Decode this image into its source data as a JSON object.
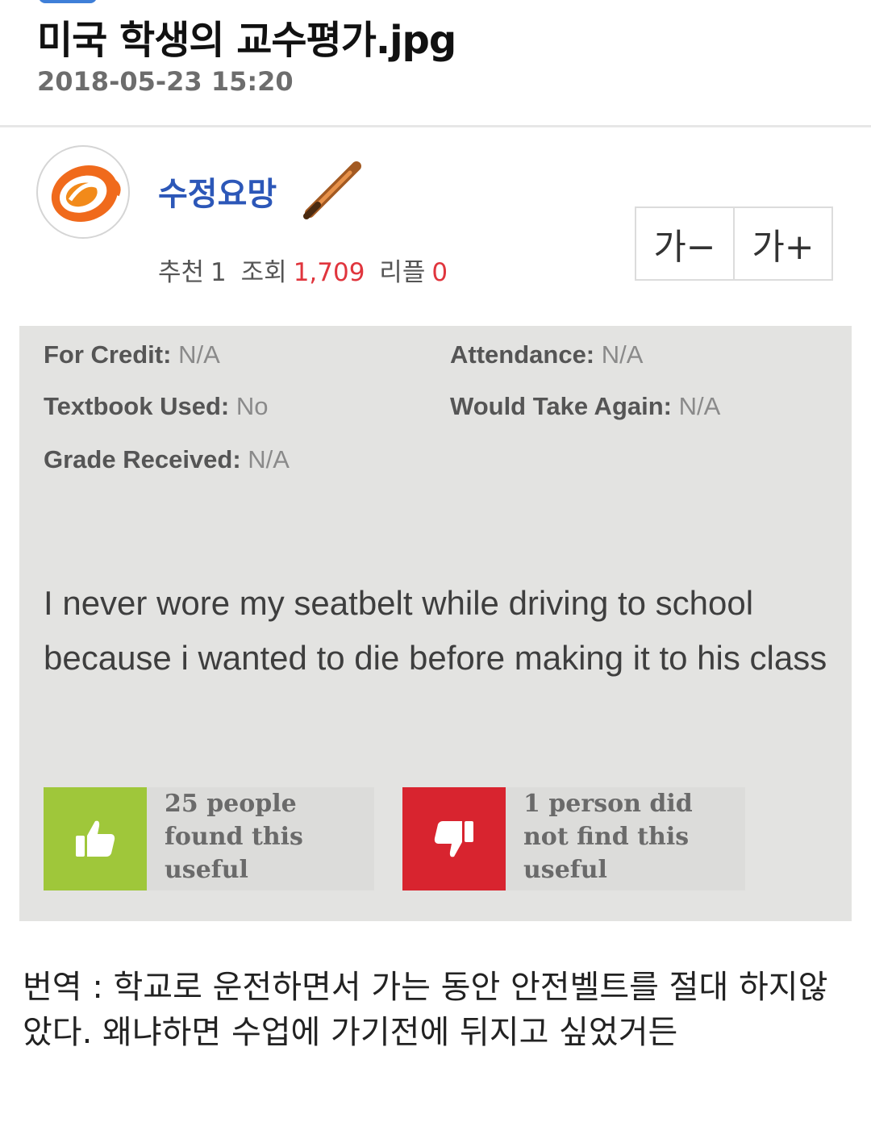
{
  "post": {
    "title": "미국 학생의 교수평가.jpg",
    "datetime": "2018-05-23 15:20"
  },
  "author": {
    "nickname": "수정요망",
    "stats": {
      "recommend_label": "추천",
      "recommend_count": "1",
      "views_label": "조회",
      "views_count": "1,709",
      "replies_label": "리플",
      "replies_count": "0"
    }
  },
  "font_size_controls": {
    "decrease_label": "가−",
    "increase_label": "가+"
  },
  "image_content": {
    "fields": [
      {
        "key": "For Credit:",
        "value": "N/A"
      },
      {
        "key": "Attendance:",
        "value": "N/A"
      },
      {
        "key": "Textbook Used:",
        "value": "No"
      },
      {
        "key": "Would Take Again:",
        "value": "N/A"
      },
      {
        "key": "Grade Received:",
        "value": "N/A"
      }
    ],
    "review_text": "I never wore my seatbelt while driving to school because i wanted to die before making it to his class",
    "useful_votes": {
      "up_text": "25 people found this useful",
      "down_text": "1 person did not find this useful"
    }
  },
  "translation": "번역 : 학교로 운전하면서 가는 동안 안전벨트를 절대 하지않았다. 왜냐하면 수업에 가기전에 뒤지고 싶었거든",
  "colors": {
    "nickname": "#2c57b8",
    "highlight_number": "#e0353d",
    "thumbs_up": "#9fc73a",
    "thumbs_down": "#d8242f",
    "card_background": "#e3e3e1"
  },
  "icons": {
    "avatar": "orange-swirl-logo-icon",
    "level": "bat-icon",
    "vote_up": "thumbs-up-icon",
    "vote_down": "thumbs-down-icon"
  }
}
